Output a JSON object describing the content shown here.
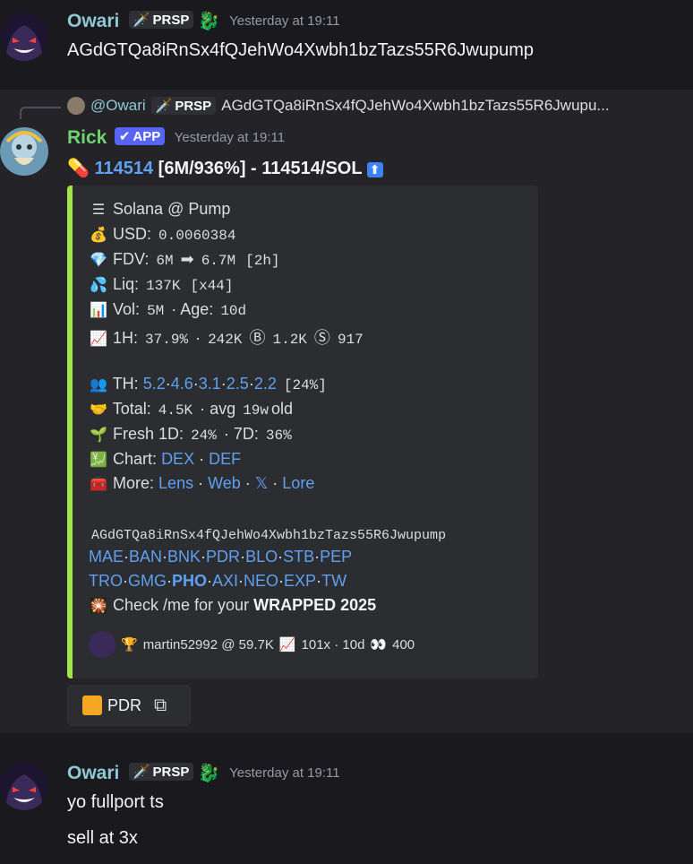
{
  "msg1": {
    "user": "Owari",
    "badge": "PRSP",
    "time": "Yesterday at 19:11",
    "text": "AGdGTQa8iRnSx4fQJehWo4Xwbh1bzTazs55R6Jwupump"
  },
  "reply": {
    "user": "@Owari",
    "badge": "PRSP",
    "text": "AGdGTQa8iRnSx4fQJehWo4Xwbh1bzTazs55R6Jwupu..."
  },
  "msg2": {
    "user": "Rick",
    "badge": "APP",
    "time": "Yesterday at 19:11",
    "ticker": "114514",
    "headline_rest": " [6M/936%] - 114514/SOL"
  },
  "embed": {
    "chain": "Solana @ Pump",
    "usd_label": "USD:",
    "usd": "0.0060384",
    "fdv_label": "FDV:",
    "fdv_from": "6M",
    "fdv_to": "6.7M",
    "fdv_time": "[2h]",
    "liq_label": "Liq:",
    "liq": "137K",
    "liq_mult": "[x44]",
    "vol_label": "Vol:",
    "vol": "5M",
    "age_label": "· Age:",
    "age": "10d",
    "h1_label": "1H:",
    "h1_pct": "37.9%",
    "h1_vol": "242K",
    "h1_buys": "1.2K",
    "h1_sells": "917",
    "th_label": "TH:",
    "th_values": [
      "5.2",
      "4.6",
      "3.1",
      "2.5",
      "2.2"
    ],
    "th_pct": "[24%]",
    "total_label": "Total:",
    "total": "4.5K",
    "avg_label": "· avg",
    "avg": "19w",
    "old": "old",
    "fresh_label": "Fresh 1D:",
    "fresh_1d": "24%",
    "fresh_7d_label": "· 7D:",
    "fresh_7d": "36%",
    "chart_label": "Chart:",
    "chart_links": [
      "DEX",
      "DEF"
    ],
    "more_label": "More:",
    "more_links": [
      "Lens",
      "Web",
      "𝕏",
      "Lore"
    ],
    "address": "AGdGTQa8iRnSx4fQJehWo4Xwbh1bzTazs55R6Jwupump",
    "bots_row1": [
      "MAE",
      "BAN",
      "BNK",
      "PDR",
      "BLO",
      "STB",
      "PEP"
    ],
    "bots_row2": [
      "TRO",
      "GMG",
      "PHO",
      "AXI",
      "NEO",
      "EXP",
      "TW"
    ],
    "wrapped_prefix": "Check /me for your ",
    "wrapped_bold": "WRAPPED 2025",
    "footer": "martin52992 @ 59.7K",
    "footer_mult": "101x · 10d",
    "footer_views": "400"
  },
  "button": {
    "label": "PDR"
  },
  "msg3": {
    "user": "Owari",
    "badge": "PRSP",
    "time": "Yesterday at 19:11",
    "line1": "yo fullport ts",
    "line2": "sell at 3x"
  },
  "colors": {
    "accent_bar": "#a4e445",
    "link": "#5fa0f0",
    "app_badge": "#5865f2"
  }
}
